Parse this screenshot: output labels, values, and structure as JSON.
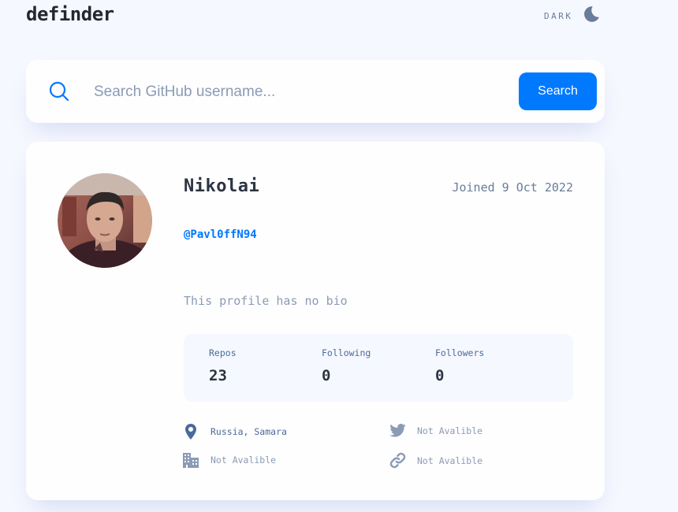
{
  "header": {
    "logo": "definder",
    "theme_label": "DARK",
    "theme_icon": "moon-icon"
  },
  "search": {
    "placeholder": "Search GitHub username...",
    "button_label": "Search",
    "icon": "search-icon"
  },
  "profile": {
    "name": "Nikolai",
    "joined": "Joined 9 Oct 2022",
    "login": "@Pavl0ffN94",
    "bio": "This profile has no bio",
    "stats": [
      {
        "label": "Repos",
        "value": "23"
      },
      {
        "label": "Following",
        "value": "0"
      },
      {
        "label": "Followers",
        "value": "0"
      }
    ],
    "links": {
      "location": {
        "text": "Russia, Samara",
        "icon": "location-pin-icon"
      },
      "twitter": {
        "text": "Not Avalible",
        "icon": "twitter-icon"
      },
      "company": {
        "text": "Not Avalible",
        "icon": "company-building-icon"
      },
      "website": {
        "text": "Not Avalible",
        "icon": "link-icon"
      }
    }
  },
  "colors": {
    "accent": "#0079ff",
    "background": "#f6f8ff",
    "card": "#fefefe",
    "text_dark": "#2b3442",
    "text_muted": "#697c9a"
  }
}
